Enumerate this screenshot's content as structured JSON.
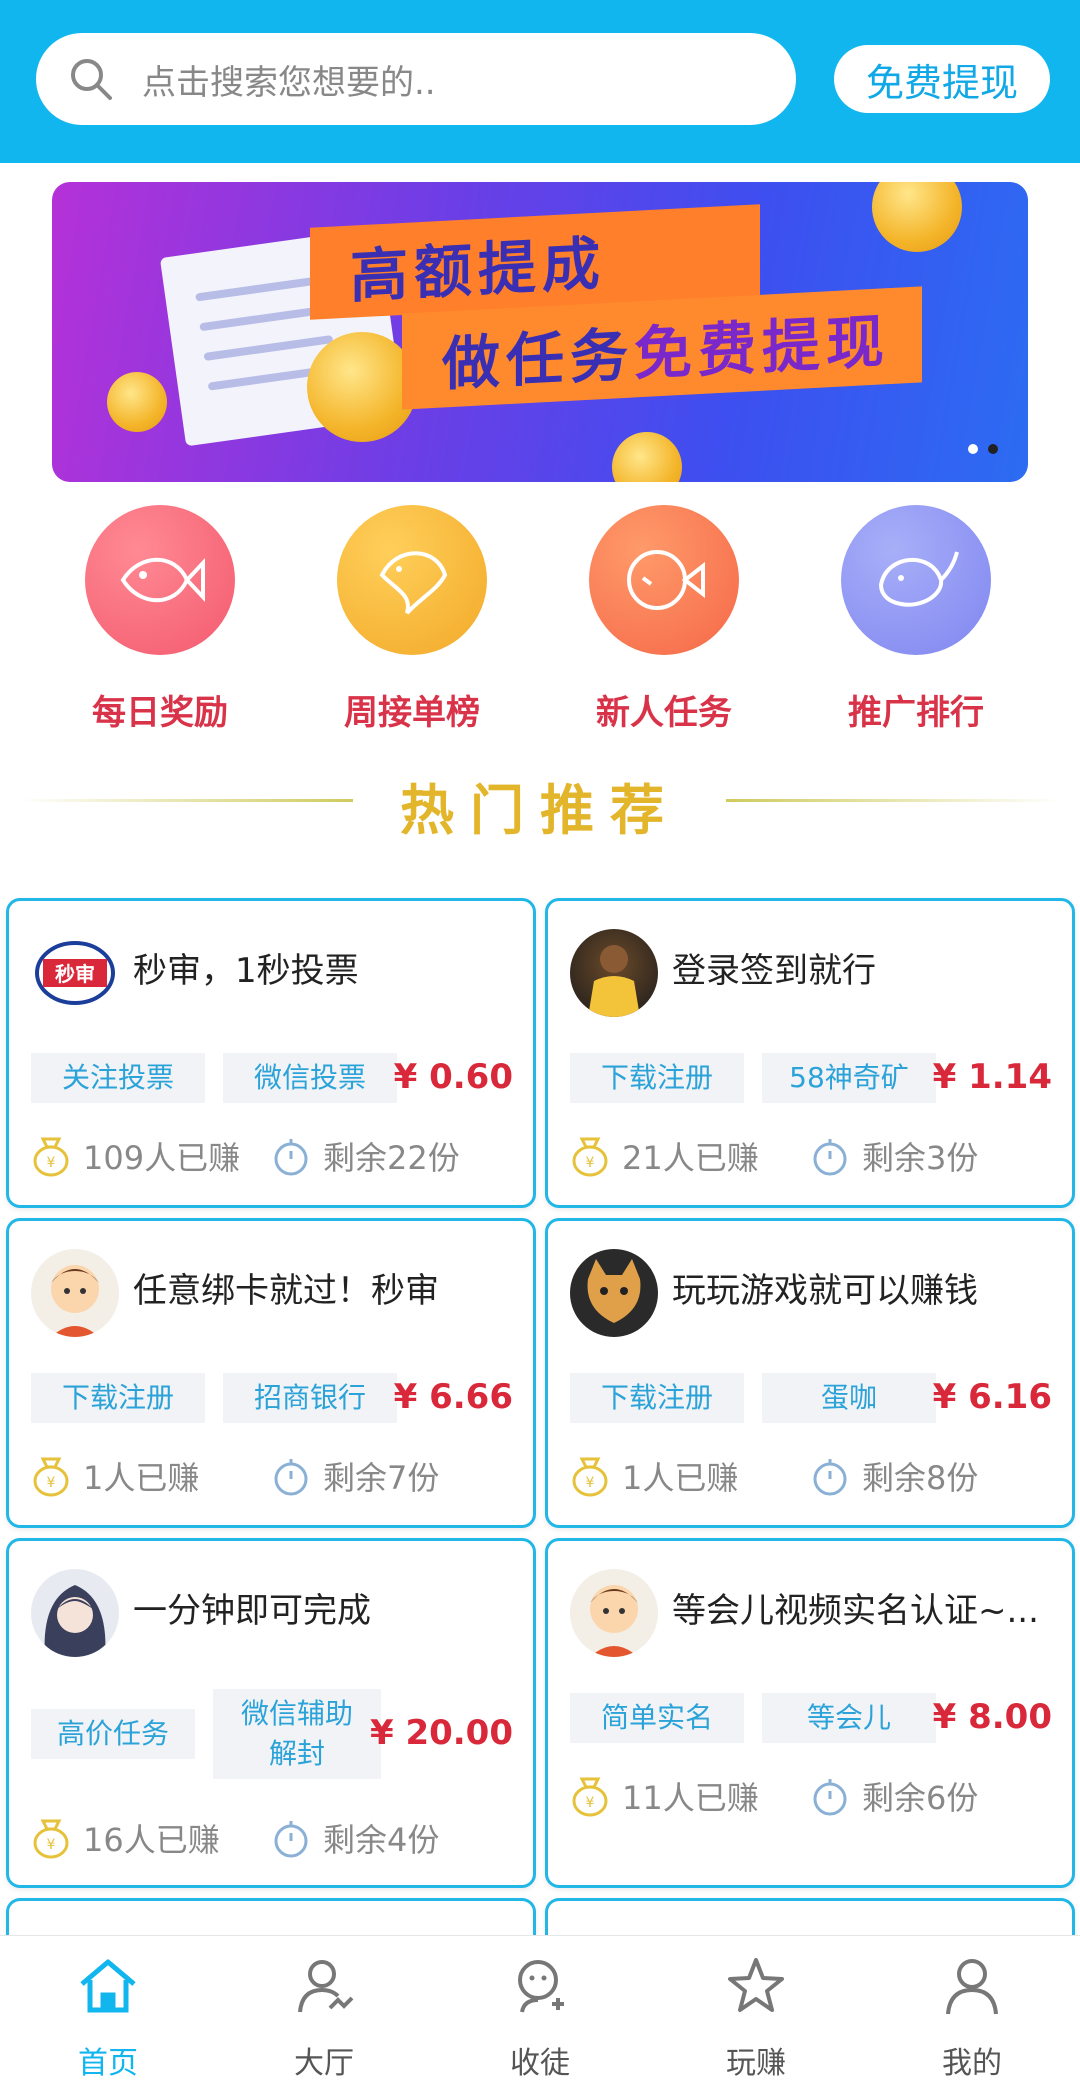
{
  "header": {
    "search_placeholder": "点击搜索您想要的..",
    "withdraw_label": "免费提现"
  },
  "banner": {
    "line1": "高额提成",
    "line2_a": "做任务",
    "line2_b": "免费提现"
  },
  "categories": [
    {
      "label": "每日奖励",
      "icon": "fish-icon",
      "color": "#f35a6f"
    },
    {
      "label": "周接单榜",
      "icon": "dolphin-icon",
      "color": "#f2a928"
    },
    {
      "label": "新人任务",
      "icon": "puffer-fish-icon",
      "color": "#f56848"
    },
    {
      "label": "推广排行",
      "icon": "whale-icon",
      "color": "#7f86f0"
    }
  ],
  "hot_title": "热门推荐",
  "cards": [
    {
      "title": "秒审，1秒投票",
      "tags": [
        "关注投票",
        "微信投票"
      ],
      "price": "¥ 0.60",
      "earned": "109人已赚",
      "remaining": "剩余22份",
      "avatar": "miaoshen-logo"
    },
    {
      "title": "登录签到就行",
      "tags": [
        "下载注册",
        "58神奇矿"
      ],
      "price": "¥ 1.14",
      "earned": "21人已赚",
      "remaining": "剩余3份",
      "avatar": "basketball-player-avatar"
    },
    {
      "title": "任意绑卡就过！秒审",
      "tags": [
        "下载注册",
        "招商银行"
      ],
      "price": "¥ 6.66",
      "earned": "1人已赚",
      "remaining": "剩余7份",
      "avatar": "cartoon-man-avatar"
    },
    {
      "title": "玩玩游戏就可以赚钱",
      "tags": [
        "下载注册",
        "蛋咖"
      ],
      "price": "¥ 6.16",
      "earned": "1人已赚",
      "remaining": "剩余8份",
      "avatar": "cat-avatar"
    },
    {
      "title": "一分钟即可完成",
      "tags": [
        "高价任务",
        "微信辅助",
        "解封"
      ],
      "price": "¥ 20.00",
      "earned": "16人已赚",
      "remaining": "剩余4份",
      "avatar": "anime-girl-avatar"
    },
    {
      "title": "等会儿视频实名认证~...",
      "tags": [
        "简单实名",
        "等会儿"
      ],
      "price": "¥ 8.00",
      "earned": "11人已赚",
      "remaining": "剩余6份",
      "avatar": "cartoon-man-avatar"
    }
  ],
  "nav": [
    {
      "label": "首页",
      "icon": "home-icon",
      "active": true
    },
    {
      "label": "大厅",
      "icon": "hall-user-icon",
      "active": false
    },
    {
      "label": "收徒",
      "icon": "add-friend-icon",
      "active": false
    },
    {
      "label": "玩赚",
      "icon": "star-icon",
      "active": false
    },
    {
      "label": "我的",
      "icon": "profile-icon",
      "active": false
    }
  ],
  "colors": {
    "brand": "#12b6ef",
    "price": "#d8283a",
    "tag_text": "#2ba3d9",
    "hot_title": "#e3b52b"
  }
}
